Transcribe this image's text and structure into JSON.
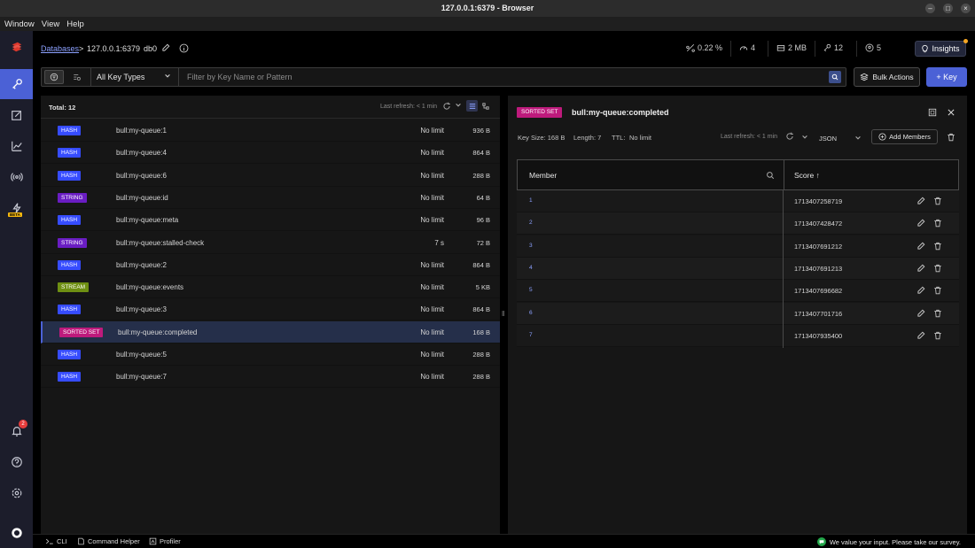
{
  "window": {
    "title": "127.0.0.1:6379 - Browser"
  },
  "menu": [
    "Window",
    "View",
    "Help"
  ],
  "header": {
    "crumb_databases": "Databases",
    "crumb_sep": ">",
    "crumb_host": "127.0.0.1:6379",
    "crumb_db": "db0",
    "stats": {
      "cpu": "0.22 %",
      "ops": "4",
      "memory": "2 MB",
      "keys": "12",
      "clients": "5"
    },
    "insights_label": "Insights"
  },
  "filter": {
    "key_type": "All Key Types",
    "placeholder": "Filter by Key Name or Pattern",
    "bulk_actions": "Bulk Actions",
    "add_key": "+ Key"
  },
  "keylist": {
    "total": "Total: 12",
    "last_refresh": "Last refresh: < 1 min",
    "rows": [
      {
        "type": "HASH",
        "name": "bull:my-queue:1",
        "ttl": "No limit",
        "size": "936 B"
      },
      {
        "type": "HASH",
        "name": "bull:my-queue:4",
        "ttl": "No limit",
        "size": "864 B"
      },
      {
        "type": "HASH",
        "name": "bull:my-queue:6",
        "ttl": "No limit",
        "size": "288 B"
      },
      {
        "type": "STRING",
        "name": "bull:my-queue:id",
        "ttl": "No limit",
        "size": "64 B"
      },
      {
        "type": "HASH",
        "name": "bull:my-queue:meta",
        "ttl": "No limit",
        "size": "96 B"
      },
      {
        "type": "STRING",
        "name": "bull:my-queue:stalled-check",
        "ttl": "7 s",
        "size": "72 B"
      },
      {
        "type": "HASH",
        "name": "bull:my-queue:2",
        "ttl": "No limit",
        "size": "864 B"
      },
      {
        "type": "STREAM",
        "name": "bull:my-queue:events",
        "ttl": "No limit",
        "size": "5 KB"
      },
      {
        "type": "HASH",
        "name": "bull:my-queue:3",
        "ttl": "No limit",
        "size": "864 B"
      },
      {
        "type": "SORTED SET",
        "name": "bull:my-queue:completed",
        "ttl": "No limit",
        "size": "168 B"
      },
      {
        "type": "HASH",
        "name": "bull:my-queue:5",
        "ttl": "No limit",
        "size": "288 B"
      },
      {
        "type": "HASH",
        "name": "bull:my-queue:7",
        "ttl": "No limit",
        "size": "288 B"
      }
    ],
    "selected_index": 9
  },
  "type_colors": {
    "HASH": "#364cff",
    "STRING": "#6a1dc3",
    "STREAM": "#6e8f12",
    "SORTED SET": "#be1a7c"
  },
  "detail": {
    "type": "SORTED SET",
    "key": "bull:my-queue:completed",
    "key_size": "Key Size: 168 B",
    "length": "Length: 7",
    "ttl_label": "TTL:",
    "ttl_value": "No limit",
    "last_refresh": "Last refresh: < 1 min",
    "format": "JSON",
    "add_members": "Add Members",
    "col_member": "Member",
    "col_score": "Score",
    "members": [
      {
        "member": "1",
        "score": "1713407258719"
      },
      {
        "member": "2",
        "score": "1713407428472"
      },
      {
        "member": "3",
        "score": "1713407691212"
      },
      {
        "member": "4",
        "score": "1713407691213"
      },
      {
        "member": "5",
        "score": "1713407696682"
      },
      {
        "member": "6",
        "score": "1713407701716"
      },
      {
        "member": "7",
        "score": "1713407935400"
      }
    ]
  },
  "rail": {
    "notifications": "2",
    "beta": "BETA"
  },
  "footer": {
    "cli": "CLI",
    "helper": "Command Helper",
    "profiler": "Profiler",
    "survey": "We value your input. Please take our survey."
  }
}
